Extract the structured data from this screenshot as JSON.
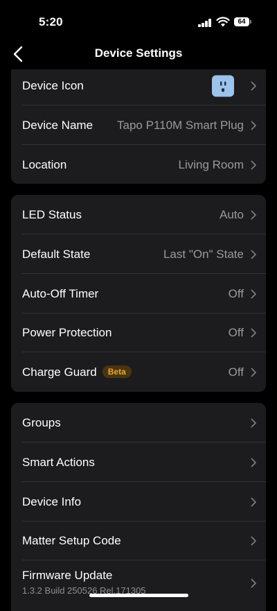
{
  "status_bar": {
    "time": "5:20",
    "battery": "64",
    "signal_icon": "cellular-signal-icon",
    "wifi_icon": "wifi-icon"
  },
  "nav": {
    "title": "Device Settings",
    "back_icon": "chevron-left-icon"
  },
  "sections": [
    {
      "rows": [
        {
          "label": "Device Icon",
          "value": "",
          "icon": "smart-plug-icon",
          "icon_color": "#9cc4ec"
        },
        {
          "label": "Device Name",
          "value": "Tapo P110M Smart Plug"
        },
        {
          "label": "Location",
          "value": "Living Room"
        }
      ]
    },
    {
      "rows": [
        {
          "label": "LED Status",
          "value": "Auto"
        },
        {
          "label": "Default State",
          "value": "Last \"On\" State"
        },
        {
          "label": "Auto-Off Timer",
          "value": "Off"
        },
        {
          "label": "Power Protection",
          "value": "Off"
        },
        {
          "label": "Charge Guard",
          "badge": "Beta",
          "value": "Off"
        }
      ]
    },
    {
      "rows": [
        {
          "label": "Groups"
        },
        {
          "label": "Smart Actions"
        },
        {
          "label": "Device Info"
        },
        {
          "label": "Matter Setup Code"
        },
        {
          "label": "Firmware Update",
          "subtitle": "1.3.2 Build 250526 Rel.171305"
        }
      ]
    }
  ],
  "colors": {
    "background": "#000000",
    "card": "#1c1c1e",
    "secondary_text": "#9a9a9e",
    "beta_badge": "#e8a838"
  }
}
